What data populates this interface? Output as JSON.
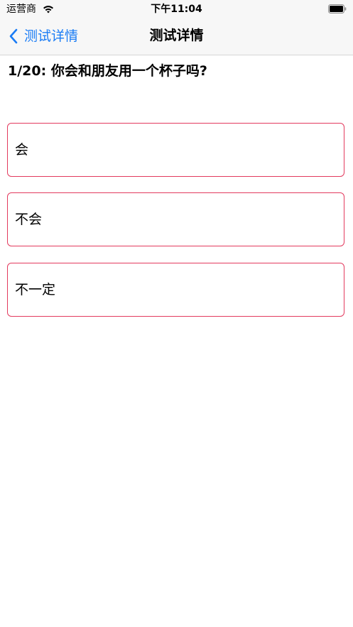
{
  "status_bar": {
    "carrier": "运营商",
    "time": "下午11:04",
    "wifi_icon": "wifi-icon",
    "battery_icon": "battery-icon"
  },
  "nav": {
    "back_label": "测试详情",
    "back_icon": "chevron-left-icon",
    "title": "测试详情"
  },
  "question": {
    "text": "1/20: 你会和朋友用一个杯子吗?"
  },
  "options": [
    {
      "label": "会"
    },
    {
      "label": "不会"
    },
    {
      "label": "不一定"
    }
  ],
  "colors": {
    "accent": "#1a7cf5",
    "option_border": "#e33a5e",
    "bar_background": "#f7f7f7"
  }
}
